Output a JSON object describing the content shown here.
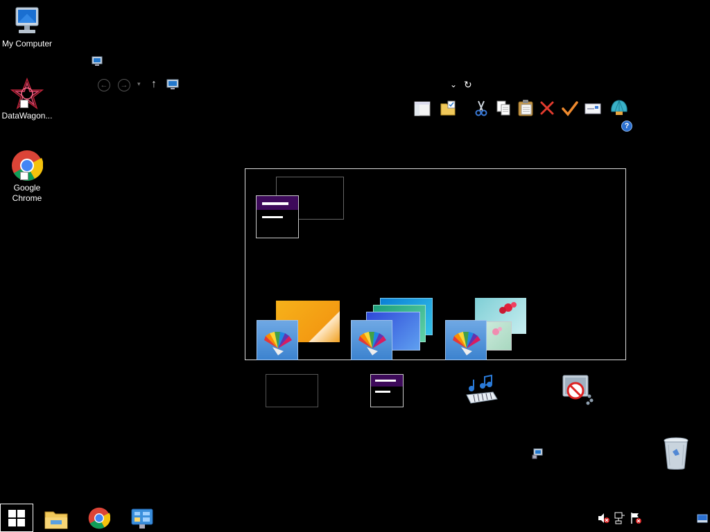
{
  "desktop": {
    "icons": [
      {
        "label": "My Computer",
        "icon": "computer-icon"
      },
      {
        "label": "DataWagon...",
        "icon": "datawagon-icon"
      },
      {
        "label": "Google Chrome",
        "icon": "chrome-icon"
      }
    ],
    "recycle_bin": {
      "icon": "recycle-bin-icon"
    }
  },
  "explorer": {
    "nav": {
      "back": "back-icon",
      "forward": "forward-icon",
      "dropdown": "recent-locations-icon",
      "up": "up-icon",
      "location": "this-pc-icon",
      "address_dropdown": "chevron-down-icon",
      "refresh": "refresh-icon"
    },
    "toolbar": [
      "layout-icon",
      "folder-options-icon",
      "cut-icon",
      "copy-icon",
      "paste-icon",
      "delete-icon",
      "check-icon",
      "mail-icon",
      "shell-icon",
      "help-icon"
    ]
  },
  "personalize": {
    "themes": [
      "theme-high-contrast",
      "theme-windows",
      "theme-windows-8",
      "theme-flowers"
    ],
    "settings": [
      "desktop-background",
      "color",
      "sounds",
      "screen-saver"
    ]
  },
  "taskbar": {
    "pinned": [
      "start-icon",
      "file-explorer-icon",
      "chrome-icon",
      "control-panel-icon"
    ],
    "tray": [
      "volume-muted-icon",
      "network-icon",
      "action-center-icon",
      "show-desktop-icon"
    ]
  },
  "colors": {
    "background": "#000000",
    "accent_purple": "#3d0a5a",
    "chrome_red": "#db4437",
    "chrome_yellow": "#f4c20d",
    "chrome_green": "#0f9d58",
    "chrome_blue": "#4285f4"
  }
}
